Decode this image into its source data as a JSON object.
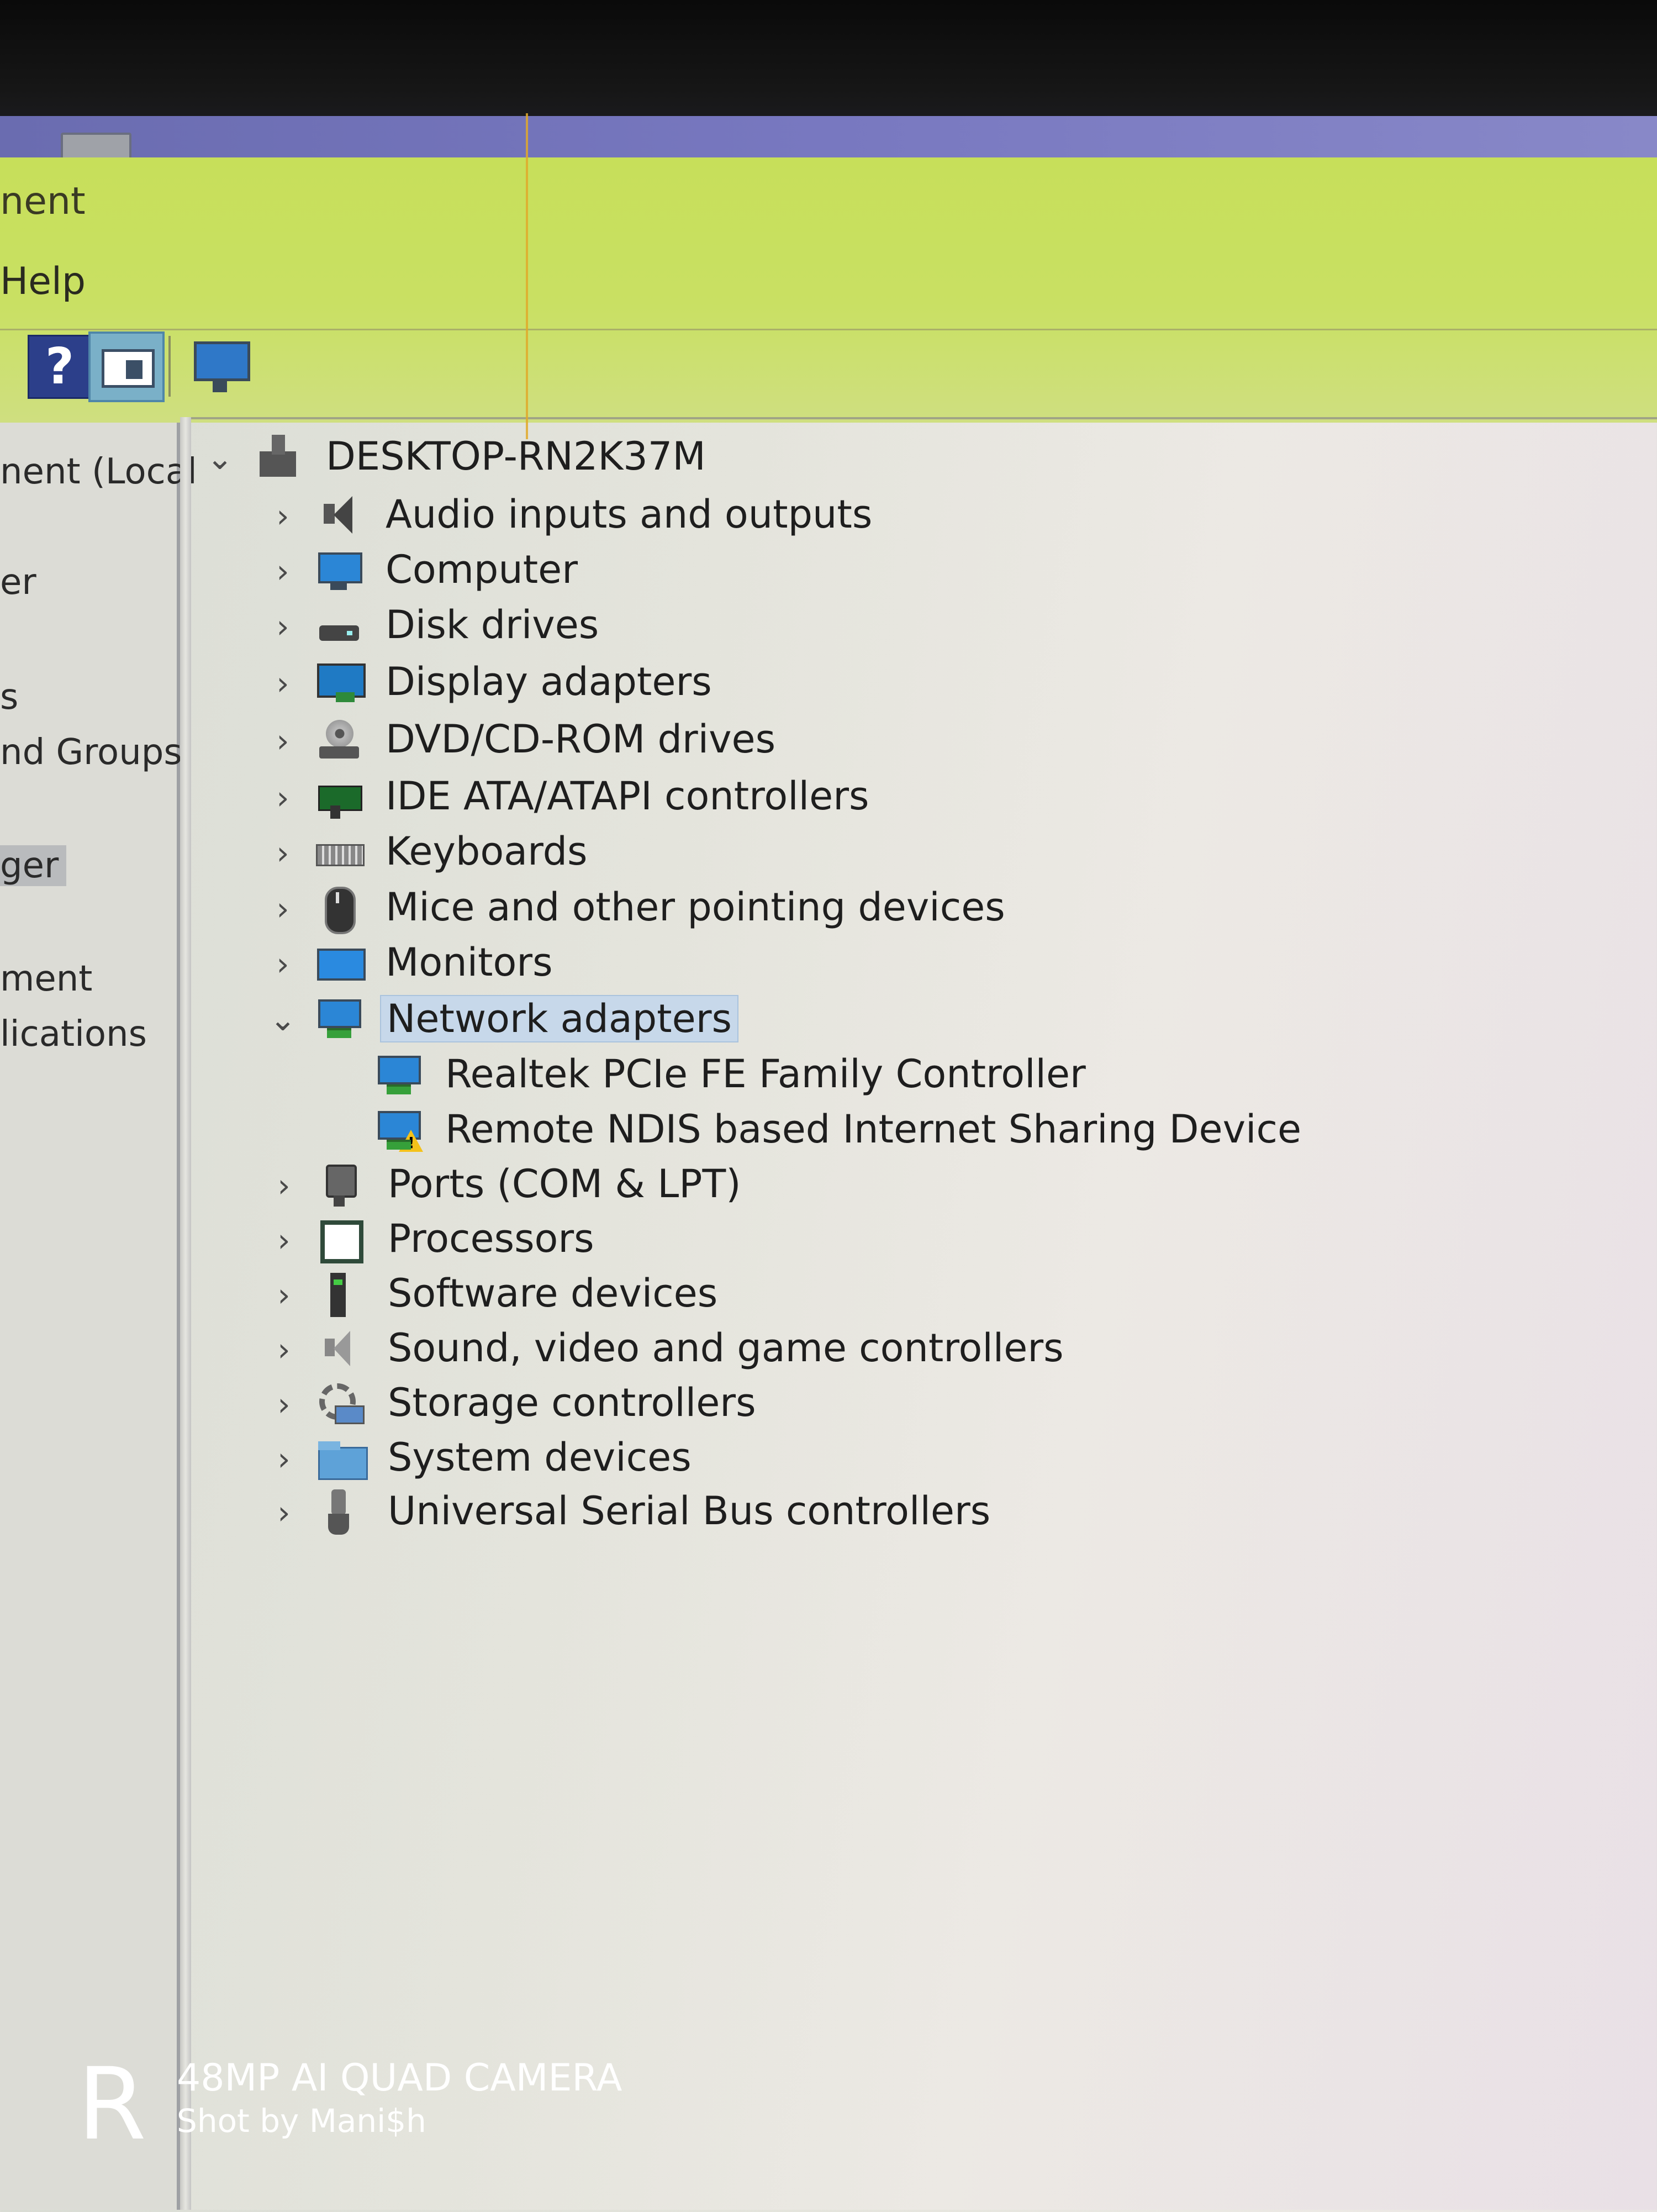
{
  "window": {
    "title_fragment": "nent"
  },
  "menubar": {
    "help_label": "Help"
  },
  "toolbar": {
    "help_glyph": "?"
  },
  "left_pane": {
    "items": [
      "nent (Local",
      "er",
      "s",
      "nd Groups",
      "ger",
      "ment",
      "lications"
    ],
    "selected_index": 4
  },
  "tree": {
    "root": "DESKTOP-RN2K37M",
    "items": [
      {
        "label": "Audio inputs and outputs",
        "icon": "speaker-icon",
        "expanded": false
      },
      {
        "label": "Computer",
        "icon": "computer-icon",
        "expanded": false
      },
      {
        "label": "Disk drives",
        "icon": "disk-drive-icon",
        "expanded": false
      },
      {
        "label": "Display adapters",
        "icon": "display-adapter-icon",
        "expanded": false
      },
      {
        "label": "DVD/CD-ROM drives",
        "icon": "dvd-drive-icon",
        "expanded": false
      },
      {
        "label": "IDE ATA/ATAPI controllers",
        "icon": "ide-controller-icon",
        "expanded": false
      },
      {
        "label": "Keyboards",
        "icon": "keyboard-icon",
        "expanded": false
      },
      {
        "label": "Mice and other pointing devices",
        "icon": "mouse-icon",
        "expanded": false
      },
      {
        "label": "Monitors",
        "icon": "monitor-icon",
        "expanded": false
      },
      {
        "label": "Network adapters",
        "icon": "network-adapter-icon",
        "expanded": true,
        "selected": true,
        "children": [
          {
            "label": "Realtek PCIe FE Family Controller",
            "icon": "network-adapter-icon",
            "warning": false
          },
          {
            "label": "Remote NDIS based Internet Sharing Device",
            "icon": "network-adapter-icon",
            "warning": true
          }
        ]
      },
      {
        "label": "Ports (COM & LPT)",
        "icon": "port-icon",
        "expanded": false
      },
      {
        "label": "Processors",
        "icon": "processor-icon",
        "expanded": false
      },
      {
        "label": "Software devices",
        "icon": "software-device-icon",
        "expanded": false
      },
      {
        "label": "Sound, video and game controllers",
        "icon": "sound-controller-icon",
        "expanded": false
      },
      {
        "label": "Storage controllers",
        "icon": "storage-controller-icon",
        "expanded": false
      },
      {
        "label": "System devices",
        "icon": "system-devices-icon",
        "expanded": false
      },
      {
        "label": "Universal Serial Bus controllers",
        "icon": "usb-icon",
        "expanded": false
      }
    ]
  },
  "watermark": {
    "logo": "R",
    "line1": "48MP AI QUAD CAMERA",
    "line2": "Shot by Mani$h"
  },
  "colors": {
    "header_bg": "#c9e063",
    "selection_bg": "#c7d8ea",
    "titlebar": "#7878c0",
    "warning": "#f4c21a"
  }
}
